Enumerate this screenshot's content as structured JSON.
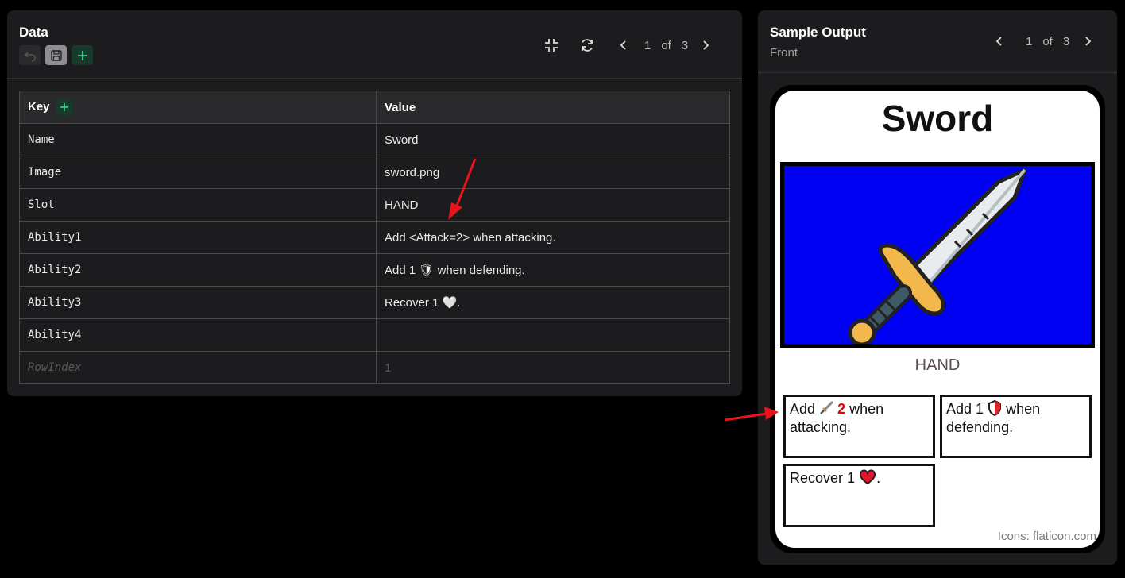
{
  "data_panel": {
    "title": "Data",
    "pager": {
      "current": "1",
      "of": "of",
      "total": "3"
    },
    "table": {
      "key_header": "Key",
      "value_header": "Value",
      "rows": [
        {
          "key": "Name",
          "value": "Sword"
        },
        {
          "key": "Image",
          "value": "sword.png"
        },
        {
          "key": "Slot",
          "value": "HAND"
        },
        {
          "key": "Ability1",
          "value": "Add <Attack=2> when attacking."
        },
        {
          "key": "Ability2",
          "value": "Add 1 🛡 when defending."
        },
        {
          "key": "Ability3",
          "value": "Recover 1 🤍."
        },
        {
          "key": "Ability4",
          "value": ""
        },
        {
          "key": "RowIndex",
          "value": "1"
        }
      ]
    }
  },
  "output_panel": {
    "title": "Sample Output",
    "subtitle": "Front",
    "pager": {
      "current": "1",
      "of": "of",
      "total": "3"
    },
    "card": {
      "title": "Sword",
      "slot": "HAND",
      "ability1": {
        "pre": "Add",
        "num": "2",
        "post": "when attacking."
      },
      "ability2": {
        "pre": "Add 1",
        "post": "when defending."
      },
      "ability3": {
        "pre": "Recover 1",
        "post": "."
      },
      "credit": "Icons: flaticon.com"
    }
  },
  "colors": {
    "panel_bg": "#1c1c1e",
    "accent_green": "#3ddc97",
    "card_image_bg": "#0000f2",
    "annotation_arrow": "#e8141c"
  },
  "icons": [
    "undo-icon",
    "save-icon",
    "plus-icon",
    "minimize-icon",
    "refresh-icon",
    "chevron-left-icon",
    "chevron-right-icon",
    "sword-icon",
    "shield-icon",
    "heart-icon"
  ]
}
